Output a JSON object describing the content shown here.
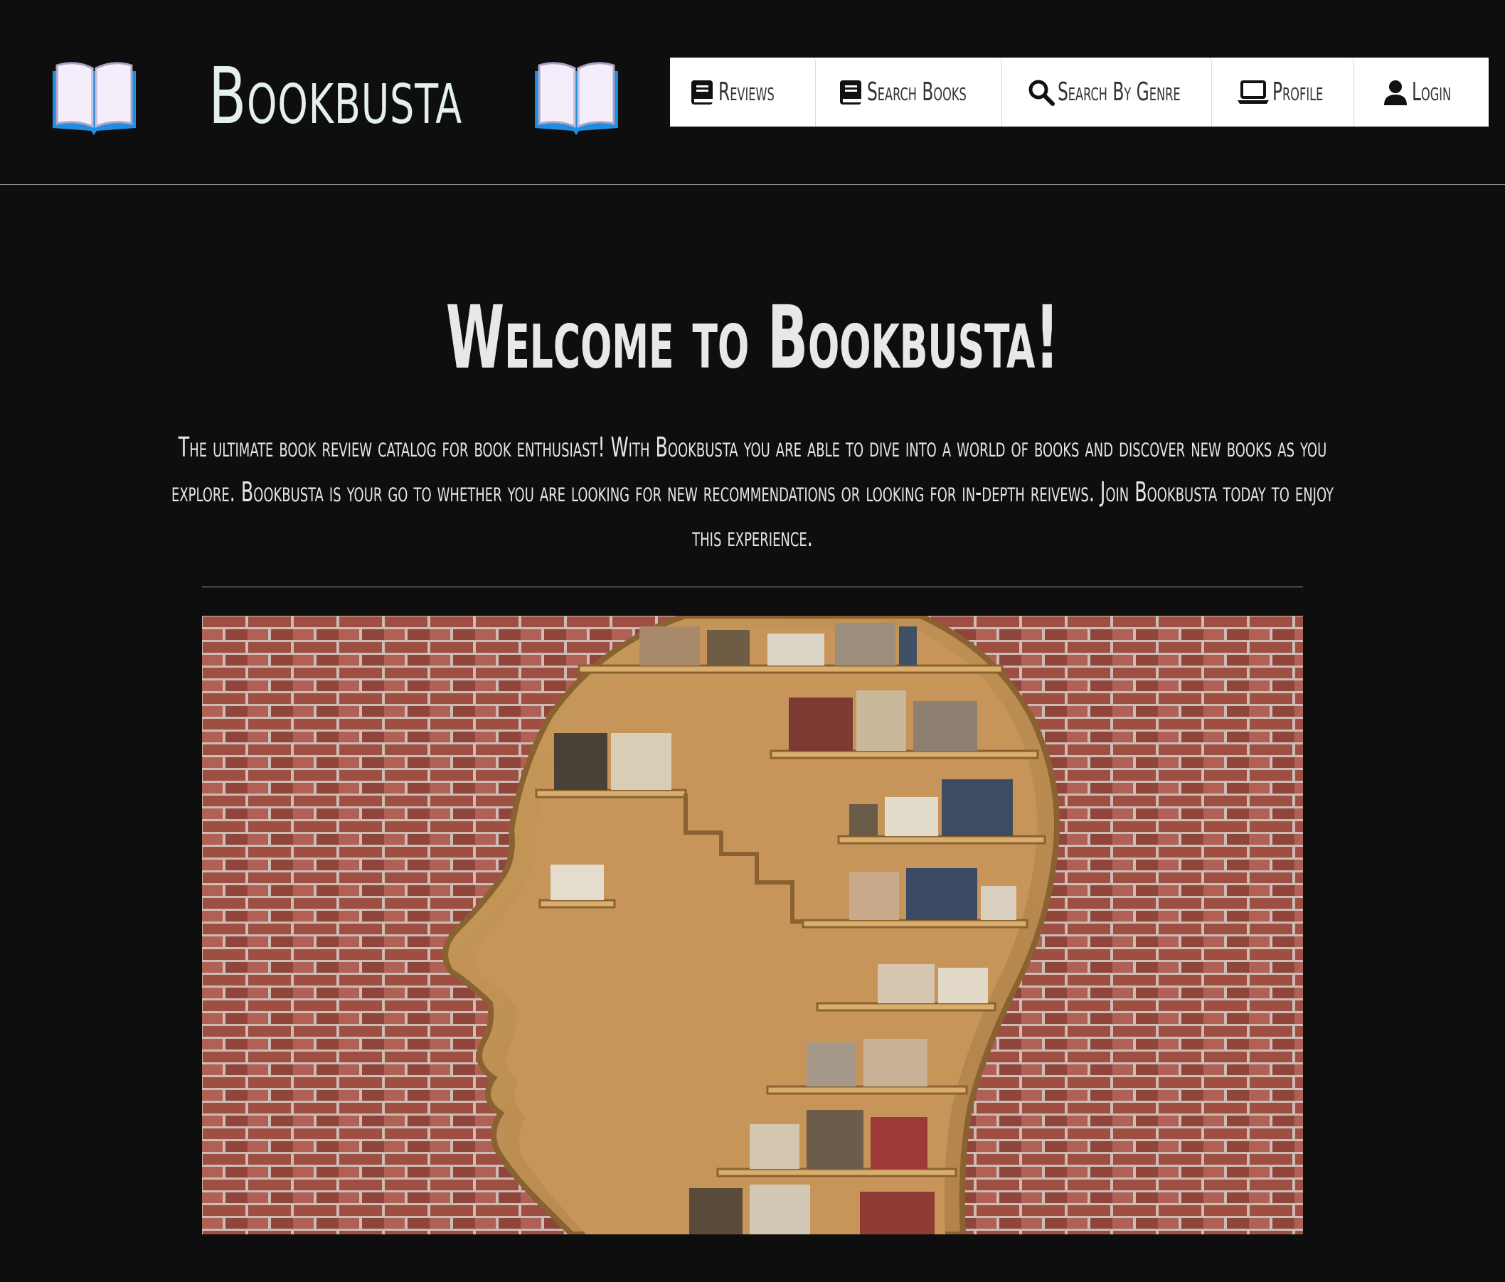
{
  "brand": {
    "name": "Bookbusta",
    "icon": "open-book-icon"
  },
  "nav": {
    "items": [
      {
        "label": "Reviews",
        "icon": "book-icon"
      },
      {
        "label": "Search Books",
        "icon": "book-icon"
      },
      {
        "label": "Search By Genre",
        "icon": "search-icon"
      },
      {
        "label": "Profile",
        "icon": "laptop-icon"
      },
      {
        "label": "Login",
        "icon": "user-icon"
      }
    ]
  },
  "main": {
    "title": "Welcome to Bookbusta!",
    "intro": "The ultimate book review catalog for book enthusiast! With Bookbusta you are able to dive into a world of books and discover new books as you explore. Bookbusta is your go to whether you are looking for new recommendations or looking for in-depth reivews. Join Bookbusta today to enjoy this experience."
  },
  "colors": {
    "background": "#0e0e0e",
    "nav_background": "#ffffff",
    "brand_text": "#e3f0ef",
    "book_icon_blue": "#1e8fe0"
  }
}
